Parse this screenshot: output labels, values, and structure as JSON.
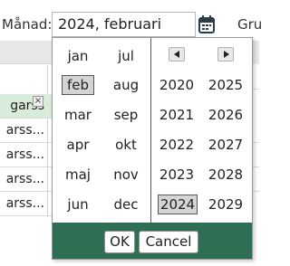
{
  "toolbar": {
    "month_label": "Månad:",
    "month_value": "2024, februari",
    "next_label": "Gru"
  },
  "background_list": {
    "rows": [
      "garss",
      "arss...",
      "arss...",
      "arss...",
      "arss..."
    ],
    "remove_glyph": "×"
  },
  "picker": {
    "months": [
      "jan",
      "jul",
      "feb",
      "aug",
      "mar",
      "sep",
      "apr",
      "okt",
      "maj",
      "nov",
      "jun",
      "dec"
    ],
    "selected_month": "feb",
    "years": [
      "2020",
      "2025",
      "2021",
      "2026",
      "2022",
      "2027",
      "2023",
      "2028",
      "2024",
      "2029"
    ],
    "selected_year": "2024",
    "ok_label": "OK",
    "cancel_label": "Cancel"
  },
  "colors": {
    "footer": "#2e6e52",
    "selected_row": "#d8ecd9",
    "selected_cell": "#d4d4d4"
  },
  "icons": [
    "calendar-icon",
    "prev-years-icon",
    "next-years-icon",
    "remove-icon"
  ]
}
